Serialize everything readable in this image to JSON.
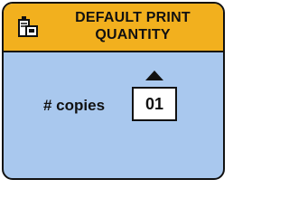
{
  "header": {
    "title_line1": "DEFAULT PRINT",
    "title_line2": "QUANTITY",
    "icon": "print-settings-icon"
  },
  "control": {
    "label": "# copies",
    "value": "01"
  },
  "colors": {
    "header_bg": "#f2b01e",
    "body_bg": "#a9c8ee",
    "border": "#111111"
  }
}
